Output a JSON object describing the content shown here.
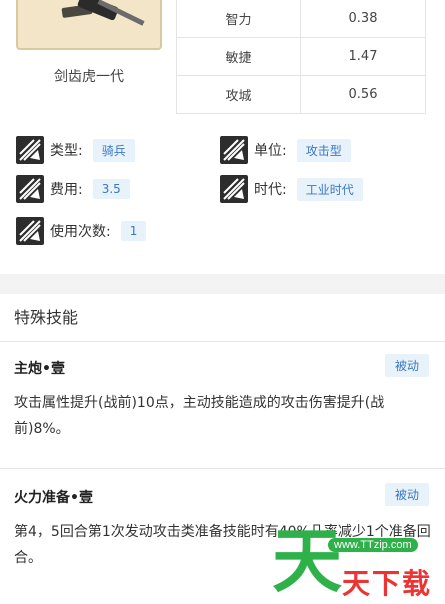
{
  "unit": {
    "name": "剑齿虎一代"
  },
  "stats": [
    {
      "label": "智力",
      "value": "0.38"
    },
    {
      "label": "敏捷",
      "value": "1.47"
    },
    {
      "label": "攻城",
      "value": "0.56"
    }
  ],
  "attributes": {
    "type": {
      "label": "类型:",
      "value": "骑兵",
      "icon": "unit-class-icon"
    },
    "unit": {
      "label": "单位:",
      "value": "攻击型",
      "icon": "unit-class-icon"
    },
    "cost": {
      "label": "费用:",
      "value": "3.5",
      "icon": "unit-class-icon"
    },
    "era": {
      "label": "时代:",
      "value": "工业时代",
      "icon": "unit-class-icon"
    },
    "uses": {
      "label": "使用次数:",
      "value": "1",
      "icon": "unit-class-icon"
    }
  },
  "section": {
    "title": "特殊技能"
  },
  "skills": [
    {
      "name": "主炮•壹",
      "badge": "被动",
      "desc": "攻击属性提升(战前)10点，主动技能造成的攻击伤害提升(战前)8%。"
    },
    {
      "name": "火力准备•壹",
      "badge": "被动",
      "desc": "第4，5回合第1次发动攻击类准备技能时有40%几率减少1个准备回合。"
    }
  ],
  "watermark": {
    "big": "天",
    "url": "www.TTzip.com",
    "text": "天下载"
  },
  "colors": {
    "tag_bg": "#e8f2fb",
    "tag_text": "#3a78c2",
    "band": "#f3f3f3",
    "watermark_green": "#2fb14a",
    "watermark_red": "#ee3333"
  }
}
